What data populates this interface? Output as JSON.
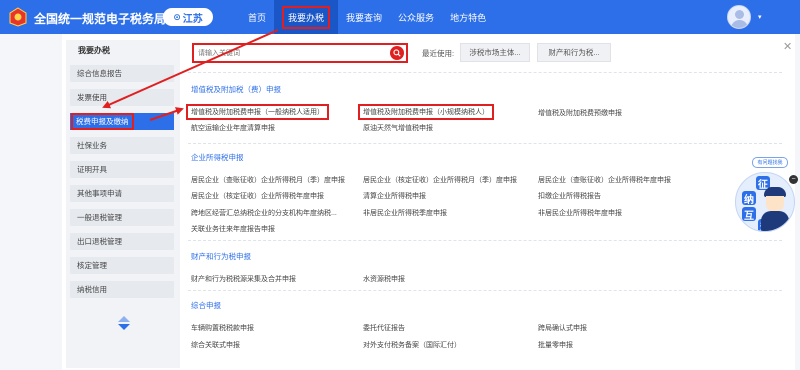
{
  "header": {
    "site_title": "全国统一规范电子税务局",
    "region": "江苏",
    "nav": [
      "首页",
      "我要办税",
      "我要查询",
      "公众服务",
      "地方特色"
    ]
  },
  "sidebar": {
    "title": "我要办税",
    "items": [
      "综合信息报告",
      "发票使用",
      "税费申报及缴纳",
      "社保业务",
      "证明开具",
      "其他事项申请",
      "一般退税管理",
      "出口退税管理",
      "核定管理",
      "纳税信用"
    ]
  },
  "search": {
    "placeholder": "请输入关键词",
    "recent_label": "最近使用:",
    "recent": [
      "涉税市场主体...",
      "财产和行为税..."
    ]
  },
  "sections": [
    {
      "title": "增值税及附加税（费）申报",
      "links": [
        "增值税及附加税费申报（一般纳税人适用）",
        "增值税及附加税费申报（小规模纳税人）",
        "增值税及附加税费预缴申报",
        "航空运输企业年度清算申报",
        "原油天然气增值税申报"
      ]
    },
    {
      "title": "企业所得税申报",
      "links": [
        "居民企业（查账征收）企业所得税月（季）度申报",
        "居民企业（核定征收）企业所得税月（季）度申报",
        "居民企业（查账征收）企业所得税年度申报",
        "居民企业（核定征收）企业所得税年度申报",
        "清算企业所得税申报",
        "扣缴企业所得税报告",
        "跨地区经营汇总纳税企业的分支机构年度纳税...",
        "非居民企业所得税季度申报",
        "非居民企业所得税年度申报",
        "关联业务往来年度报告申报"
      ]
    },
    {
      "title": "财产和行为税申报",
      "links": [
        "财产和行为税税源采集及合并申报",
        "水资源税申报"
      ]
    },
    {
      "title": "综合申报",
      "links": [
        "车辆购置税税款申报",
        "委托代征报告",
        "跨局确认式申报",
        "综合关联式申报",
        "对外支付税务备案（国际汇付）",
        "批量零申报"
      ]
    }
  ],
  "helper": {
    "bubble": "有问题找我",
    "chars": [
      "征",
      "纳",
      "互",
      "动"
    ]
  },
  "colors": {
    "primary": "#2d6fe8",
    "highlight": "#e02020"
  }
}
